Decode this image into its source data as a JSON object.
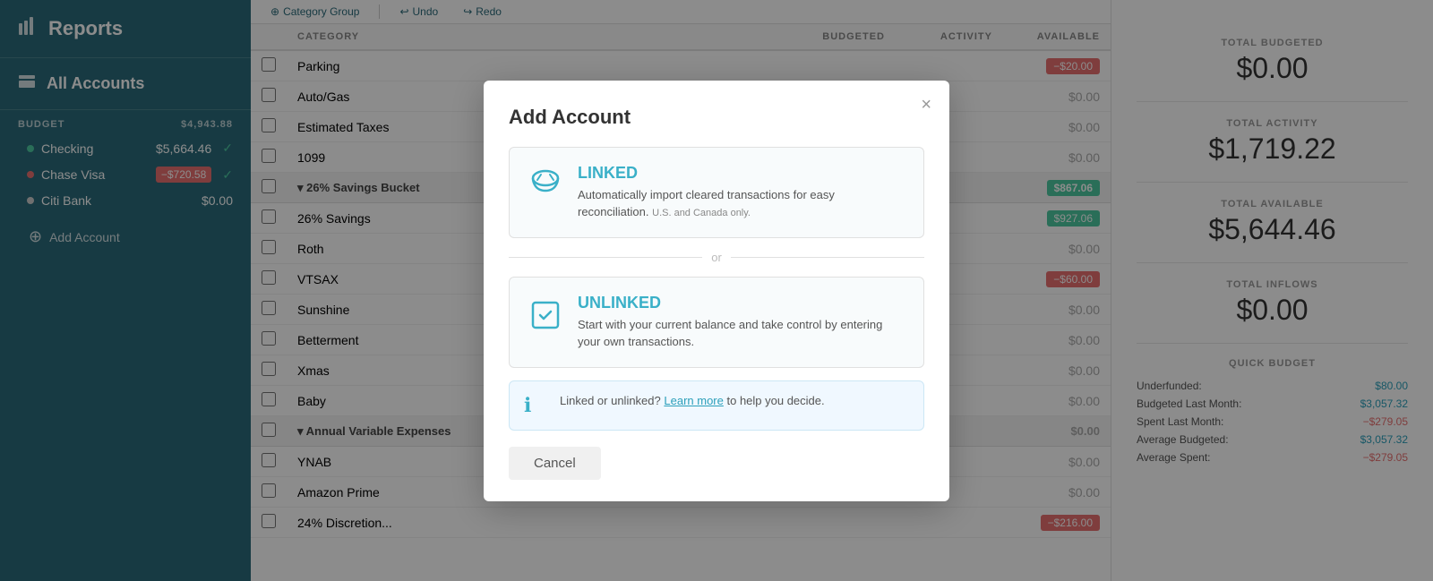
{
  "sidebar": {
    "reports_label": "Reports",
    "all_accounts_label": "All Accounts",
    "budget_label": "BUDGET",
    "budget_amount": "$4,943.88",
    "accounts": [
      {
        "name": "Checking",
        "amount": "$5,664.46",
        "dot": "teal",
        "check": true
      },
      {
        "name": "Chase Visa",
        "amount": "−$720.58",
        "dot": "red",
        "check": true,
        "neg": true
      },
      {
        "name": "Citi Bank",
        "amount": "$0.00",
        "dot": "none",
        "check": false
      }
    ],
    "add_account_label": "Add Account"
  },
  "toolbar": {
    "category_group_label": "Category Group",
    "undo_label": "Undo",
    "redo_label": "Redo"
  },
  "table": {
    "headers": [
      "",
      "CATEGORY",
      "BUDGETED",
      "ACTIVITY",
      "AVAILABLE"
    ],
    "rows": [
      {
        "type": "row",
        "name": "Parking",
        "budgeted": "",
        "activity": "",
        "available": "−$20.00",
        "avail_type": "neg"
      },
      {
        "type": "row",
        "name": "Auto/Gas",
        "budgeted": "",
        "activity": "",
        "available": "$0.00",
        "avail_type": "zero"
      },
      {
        "type": "row",
        "name": "Estimated Taxes",
        "budgeted": "",
        "activity": "",
        "available": "$0.00",
        "avail_type": "zero"
      },
      {
        "type": "row",
        "name": "1099",
        "budgeted": "",
        "activity": "",
        "available": "$0.00",
        "avail_type": "zero"
      },
      {
        "type": "group",
        "name": "▾ 26% Savings Bucket",
        "budgeted": "",
        "activity": "",
        "available": "$867.06",
        "avail_type": "pos"
      },
      {
        "type": "row",
        "name": "26% Savings",
        "budgeted": "",
        "activity": "",
        "available": "$927.06",
        "avail_type": "pos"
      },
      {
        "type": "row",
        "name": "Roth",
        "budgeted": "",
        "activity": "",
        "available": "$0.00",
        "avail_type": "zero"
      },
      {
        "type": "row",
        "name": "VTSAX",
        "budgeted": "",
        "activity": "",
        "available": "−$60.00",
        "avail_type": "neg"
      },
      {
        "type": "row",
        "name": "Sunshine",
        "budgeted": "",
        "activity": "",
        "available": "$0.00",
        "avail_type": "zero"
      },
      {
        "type": "row",
        "name": "Betterment",
        "budgeted": "",
        "activity": "",
        "available": "$0.00",
        "avail_type": "zero"
      },
      {
        "type": "row",
        "name": "Xmas",
        "budgeted": "",
        "activity": "",
        "available": "$0.00",
        "avail_type": "zero"
      },
      {
        "type": "row",
        "name": "Baby",
        "budgeted": "",
        "activity": "",
        "available": "$0.00",
        "avail_type": "zero"
      },
      {
        "type": "group",
        "name": "▾ Annual Variable Expenses",
        "budgeted": "",
        "activity": "",
        "available": "$0.00",
        "avail_type": "zero"
      },
      {
        "type": "row",
        "name": "YNAB",
        "budgeted": "",
        "activity": "",
        "available": "$0.00",
        "avail_type": "zero"
      },
      {
        "type": "row",
        "name": "Amazon Prime",
        "budgeted": "",
        "activity": "",
        "available": "$0.00",
        "avail_type": "zero"
      },
      {
        "type": "row",
        "name": "24% Discretion...",
        "budgeted": "",
        "activity": "",
        "available": "−$216.00",
        "avail_type": "neg"
      }
    ]
  },
  "right_panel": {
    "total_budgeted_label": "TOTAL BUDGETED",
    "total_budgeted_value": "$0.00",
    "total_activity_label": "TOTAL ACTIVITY",
    "total_activity_value": "$1,719.22",
    "total_available_label": "TOTAL AVAILABLE",
    "total_available_value": "$5,644.46",
    "total_inflows_label": "TOTAL INFLOWS",
    "total_inflows_value": "$0.00",
    "quick_budget_label": "QUICK BUDGET",
    "quick_rows": [
      {
        "label": "Underfunded:",
        "value": "$80.00",
        "link": true
      },
      {
        "label": "Budgeted Last Month:",
        "value": "$3,057.32",
        "link": true
      },
      {
        "label": "Spent Last Month:",
        "value": "−$279.05",
        "neg": true,
        "link": false
      },
      {
        "label": "Average Budgeted:",
        "value": "$3,057.32",
        "link": true
      },
      {
        "label": "Average Spent:",
        "value": "−$279.05",
        "neg": true,
        "link": false
      }
    ]
  },
  "modal": {
    "title": "Add Account",
    "close_label": "×",
    "linked_title": "LINKED",
    "linked_desc": "Automatically import cleared transactions for easy reconciliation.",
    "linked_note": "U.S. and Canada only.",
    "or_label": "or",
    "unlinked_title": "UNLINKED",
    "unlinked_desc": "Start with your current balance and take control by entering your own transactions.",
    "info_text": "Linked or unlinked?",
    "info_link": "Learn more",
    "info_suffix": " to help you decide.",
    "cancel_label": "Cancel"
  }
}
